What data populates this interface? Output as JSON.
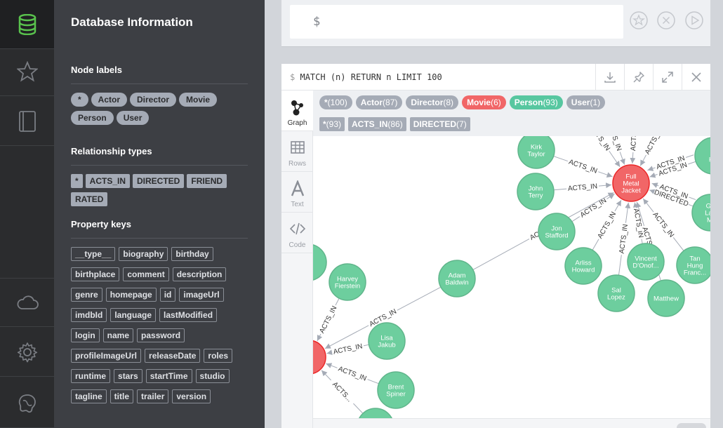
{
  "drawer": {
    "title": "Database Information",
    "node_labels_title": "Node labels",
    "node_labels": [
      "*",
      "Actor",
      "Director",
      "Movie",
      "Person",
      "User"
    ],
    "rel_types_title": "Relationship types",
    "rel_types": [
      "*",
      "ACTS_IN",
      "DIRECTED",
      "FRIEND",
      "RATED"
    ],
    "prop_keys_title": "Property keys",
    "prop_keys": [
      "__type__",
      "biography",
      "birthday",
      "birthplace",
      "comment",
      "description",
      "genre",
      "homepage",
      "id",
      "imageUrl",
      "imdbId",
      "language",
      "lastModified",
      "login",
      "name",
      "password",
      "profileImageUrl",
      "releaseDate",
      "roles",
      "runtime",
      "stars",
      "startTime",
      "studio",
      "tagline",
      "title",
      "trailer",
      "version"
    ]
  },
  "editor": {
    "prompt": "$"
  },
  "frame": {
    "query_prompt": "$",
    "query": "MATCH (n) RETURN n LIMIT 100",
    "tabs": [
      "Graph",
      "Rows",
      "Text",
      "Code"
    ]
  },
  "legend": {
    "labels": [
      {
        "name": "*",
        "count": "(100)",
        "color": "#a5abb6"
      },
      {
        "name": "Actor",
        "count": "(87)",
        "color": "#a5abb6"
      },
      {
        "name": "Director",
        "count": "(8)",
        "color": "#a5abb6"
      },
      {
        "name": "Movie",
        "count": "(6)",
        "color": "#f16667"
      },
      {
        "name": "Person",
        "count": "(93)",
        "color": "#57c7a0"
      },
      {
        "name": "User",
        "count": "(1)",
        "color": "#a5abb6"
      }
    ],
    "rels": [
      {
        "name": "*",
        "count": "(93)"
      },
      {
        "name": "ACTS_IN",
        "count": "(86)"
      },
      {
        "name": "DIRECTED",
        "count": "(7)"
      }
    ]
  },
  "colors": {
    "movie": "#f16667",
    "person": "#6dce9e",
    "person_stroke": "#60b58b",
    "movie_stroke": "#eb2728",
    "edge": "#a5abb6"
  },
  "graph": {
    "nodes": [
      {
        "id": "fmj",
        "lines": [
          "Full",
          "Metal",
          "Jacket"
        ],
        "type": "movie"
      },
      {
        "id": "m2",
        "lines": [
          "e..."
        ],
        "type": "movie"
      },
      {
        "id": "kirk",
        "lines": [
          "Kirk",
          "Taylor"
        ],
        "type": "person"
      },
      {
        "id": "john",
        "lines": [
          "John",
          "Terry"
        ],
        "type": "person"
      },
      {
        "id": "jon",
        "lines": [
          "Jon",
          "Stafford"
        ],
        "type": "person"
      },
      {
        "id": "arliss",
        "lines": [
          "Arliss",
          "Howard"
        ],
        "type": "person"
      },
      {
        "id": "sal",
        "lines": [
          "Sal",
          "Lopez"
        ],
        "type": "person"
      },
      {
        "id": "vincent",
        "lines": [
          "Vincent",
          "D'Onof..."
        ],
        "type": "person"
      },
      {
        "id": "matthew",
        "lines": [
          "Matthew"
        ],
        "type": "person"
      },
      {
        "id": "tan",
        "lines": [
          "Tan",
          "Hung",
          "Franc..."
        ],
        "type": "person"
      },
      {
        "id": "gary",
        "lines": [
          "Ga",
          "Lan",
          "Mi"
        ],
        "type": "person"
      },
      {
        "id": "dh",
        "lines": [
          "D",
          "Ha"
        ],
        "type": "person"
      },
      {
        "id": "adam",
        "lines": [
          "Adam",
          "Baldwin"
        ],
        "type": "person"
      },
      {
        "id": "harvey",
        "lines": [
          "Harvey",
          "Fierstein"
        ],
        "type": "person"
      },
      {
        "id": "lisa",
        "lines": [
          "Lisa",
          "Jakub"
        ],
        "type": "person"
      },
      {
        "id": "brent",
        "lines": [
          "Brent",
          "Spiner"
        ],
        "type": "person"
      },
      {
        "id": "a",
        "lines": [
          "A."
        ],
        "type": "person"
      },
      {
        "id": "bottom",
        "lines": [],
        "type": "person"
      }
    ],
    "edges": [
      {
        "from": "kirk",
        "to": "fmj",
        "label": "ACTS_IN"
      },
      {
        "from": "john",
        "to": "fmj",
        "label": "ACTS_IN"
      },
      {
        "from": "jon",
        "to": "fmj",
        "label": "ACTS_IN"
      },
      {
        "from": "arliss",
        "to": "fmj",
        "label": "ACTS_IN"
      },
      {
        "from": "sal",
        "to": "fmj",
        "label": "ACTS_IN"
      },
      {
        "from": "vincent",
        "to": "fmj",
        "label": "ACTS_IN"
      },
      {
        "from": "matthew",
        "to": "fmj",
        "label": "ACTS_IN"
      },
      {
        "from": "tan",
        "to": "fmj",
        "label": "ACTS_IN"
      },
      {
        "from": "gary",
        "to": "fmj",
        "label": "DIRECTED"
      },
      {
        "from": "gary",
        "to": "fmj",
        "label": "ACTS_IN"
      },
      {
        "from": "dh",
        "to": "fmj",
        "label": "ACTS_IN"
      },
      {
        "from": "dh",
        "to": "fmj",
        "label": "ACTS_IN"
      },
      {
        "from": "adam",
        "to": "fmj",
        "label": "ACTS_IN"
      },
      {
        "from": "adam",
        "to": "m2",
        "label": "ACTS_IN"
      },
      {
        "from": "harvey",
        "to": "m2",
        "label": "ACTS_IN"
      },
      {
        "from": "lisa",
        "to": "m2",
        "label": "ACTS_IN"
      },
      {
        "from": "brent",
        "to": "m2",
        "label": "ACTS_IN"
      },
      {
        "from": "bottom",
        "to": "m2",
        "label": "ACTS..."
      },
      {
        "from": "top1",
        "to": "fmj",
        "label": "ACTS_IN"
      },
      {
        "from": "top2",
        "to": "fmj",
        "label": "ACTS_IN"
      },
      {
        "from": "top3",
        "to": "fmj",
        "label": "ACTS_IN"
      },
      {
        "from": "top4",
        "to": "fmj",
        "label": "ACTS_IN"
      }
    ]
  }
}
